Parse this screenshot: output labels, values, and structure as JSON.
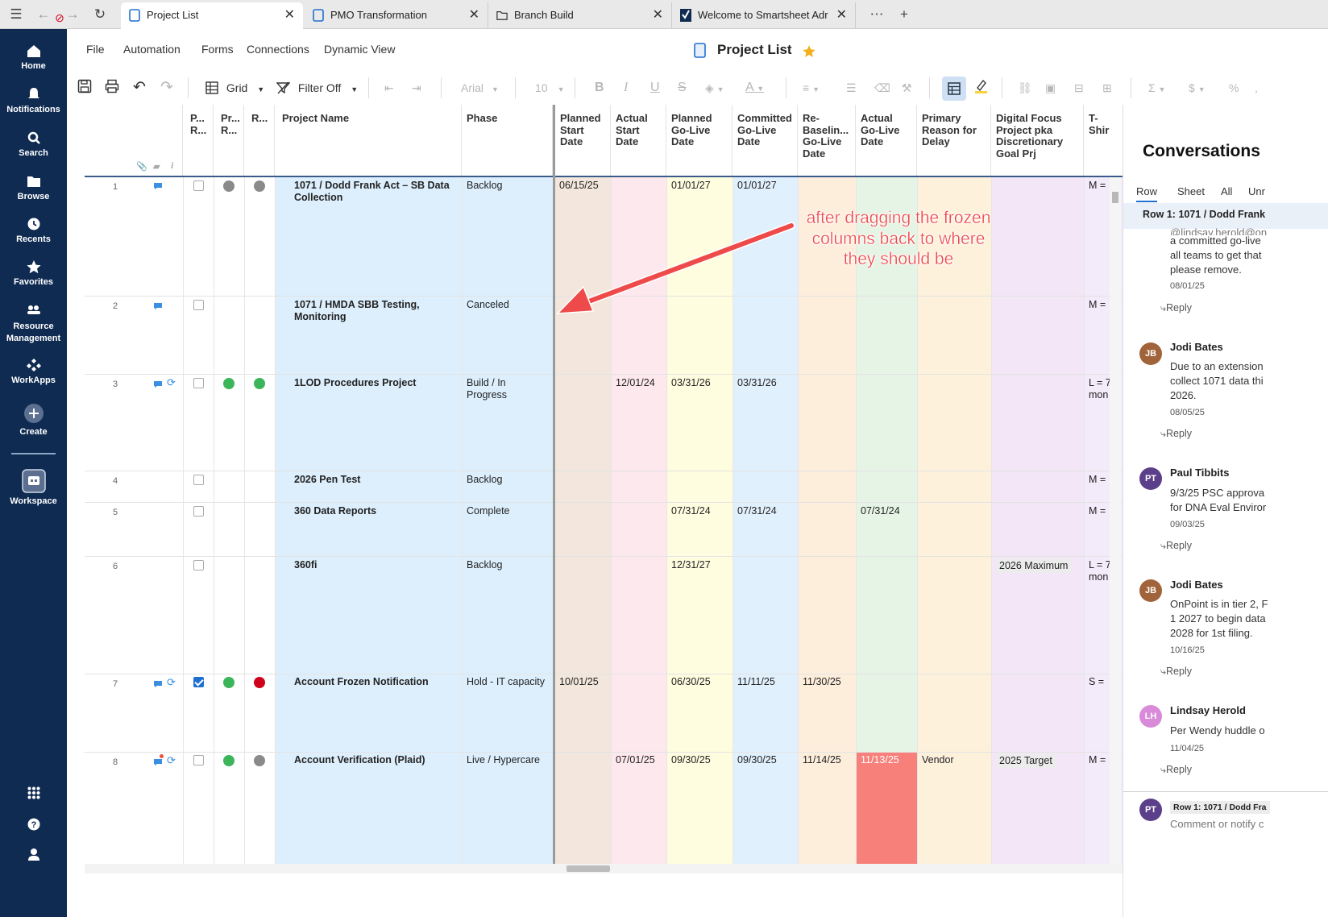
{
  "browser": {
    "tabs": [
      {
        "title": "Project List",
        "active": true
      },
      {
        "title": "PMO Transformation",
        "active": false
      },
      {
        "title": "Branch Build",
        "active": false
      },
      {
        "title": "Welcome to Smartsheet Adr",
        "active": false
      }
    ]
  },
  "nav": {
    "items": [
      "Home",
      "Notifications",
      "Search",
      "Browse",
      "Recents",
      "Favorites",
      "Resource Management",
      "WorkApps",
      "Create",
      "Workspace"
    ]
  },
  "menu": {
    "items": [
      "File",
      "Automation",
      "Forms",
      "Connections",
      "Dynamic View"
    ],
    "title": "Project List"
  },
  "toolbar": {
    "view_label": "Grid",
    "filter_label": "Filter Off",
    "font": "Arial",
    "size": "10"
  },
  "grid": {
    "columns": [
      "P... R...",
      "Pr... R...",
      "R...",
      "Project Name",
      "Phase",
      "Planned Start Date",
      "Actual Start Date",
      "Planned Go-Live Date",
      "Committed Go-Live Date",
      "Re-Baselin... Go-Live Date",
      "Actual Go-Live Date",
      "Primary Reason for Delay",
      "Digital Focus Project pka Discretionary Goal Prj",
      "T-Shir"
    ],
    "rows": [
      {
        "num": "1",
        "name": "1071 / Dodd Frank Act – SB Data Collection",
        "phase": "Backlog",
        "pstart": "06/15/25",
        "astart": "",
        "pgolive": "01/01/27",
        "cgolive": "01/01/27",
        "rgolive": "",
        "agolive": "",
        "reason": "",
        "digital": "",
        "tshirt": "M ="
      },
      {
        "num": "2",
        "name": "1071 / HMDA SBB Testing, Monitoring",
        "phase": "Canceled",
        "pstart": "",
        "astart": "",
        "pgolive": "",
        "cgolive": "",
        "rgolive": "",
        "agolive": "",
        "reason": "",
        "digital": "",
        "tshirt": "M ="
      },
      {
        "num": "3",
        "name": "1LOD Procedures Project",
        "phase": "Build / In Progress",
        "pstart": "",
        "astart": "12/01/24",
        "pgolive": "03/31/26",
        "cgolive": "03/31/26",
        "rgolive": "",
        "agolive": "",
        "reason": "",
        "digital": "",
        "tshirt": "L = 7 mon"
      },
      {
        "num": "4",
        "name": "2026 Pen Test",
        "phase": "Backlog",
        "pstart": "",
        "astart": "",
        "pgolive": "",
        "cgolive": "",
        "rgolive": "",
        "agolive": "",
        "reason": "",
        "digital": "",
        "tshirt": "M ="
      },
      {
        "num": "5",
        "name": "360 Data Reports",
        "phase": "Complete",
        "pstart": "",
        "astart": "",
        "pgolive": "07/31/24",
        "cgolive": "07/31/24",
        "rgolive": "",
        "agolive": "07/31/24",
        "reason": "",
        "digital": "",
        "tshirt": "M ="
      },
      {
        "num": "6",
        "name": "360fi",
        "phase": "Backlog",
        "pstart": "",
        "astart": "",
        "pgolive": "12/31/27",
        "cgolive": "",
        "rgolive": "",
        "agolive": "",
        "reason": "",
        "digital": "2026 Maximum",
        "tshirt": "L = 7 mon"
      },
      {
        "num": "7",
        "name": "Account Frozen Notification",
        "phase": "Hold - IT capacity",
        "pstart": "10/01/25",
        "astart": "",
        "pgolive": "06/30/25",
        "cgolive": "11/11/25",
        "rgolive": "11/30/25",
        "agolive": "",
        "reason": "",
        "digital": "",
        "tshirt": "S ="
      },
      {
        "num": "8",
        "name": "Account Verification (Plaid)",
        "phase": "Live / Hypercare",
        "pstart": "",
        "astart": "07/01/25",
        "pgolive": "09/30/25",
        "cgolive": "09/30/25",
        "rgolive": "11/14/25",
        "agolive": "11/13/25",
        "reason": "Vendor",
        "digital": "2025 Target",
        "tshirt": "M ="
      }
    ]
  },
  "annotation": "after dragging the frozen columns back to where they should be",
  "conversations": {
    "title": "Conversations",
    "tabs": [
      "Row",
      "Sheet",
      "All",
      "Unr"
    ],
    "row_header": "Row 1: 1071 / Dodd Frank",
    "first_snippet": [
      "@lindsay.herold@on",
      "a committed go-live",
      "all teams to get that",
      "please remove."
    ],
    "first_date": "08/01/25",
    "reply_label": "Reply",
    "comments": [
      {
        "initials": "JB",
        "name": "Jodi Bates",
        "lines": [
          "Due to an extension",
          "collect 1071 data thi",
          "2026."
        ],
        "date": "08/05/25",
        "color": "#a0633a"
      },
      {
        "initials": "PT",
        "name": "Paul Tibbits",
        "lines": [
          "9/3/25 PSC approva",
          "for DNA Eval Enviror"
        ],
        "date": "09/03/25",
        "color": "#5b3f8a"
      },
      {
        "initials": "JB",
        "name": "Jodi Bates",
        "lines": [
          "OnPoint is in tier 2, F",
          "1 2027 to begin data",
          "2028 for 1st filing."
        ],
        "date": "10/16/25",
        "color": "#a0633a"
      },
      {
        "initials": "LH",
        "name": "Lindsay Herold",
        "lines": [
          "Per Wendy huddle o"
        ],
        "date": "11/04/25",
        "color": "#d98ad8"
      }
    ],
    "compose": {
      "initials": "PT",
      "tag": "Row 1: 1071 / Dodd Fra",
      "placeholder": "Comment or notify c"
    }
  }
}
